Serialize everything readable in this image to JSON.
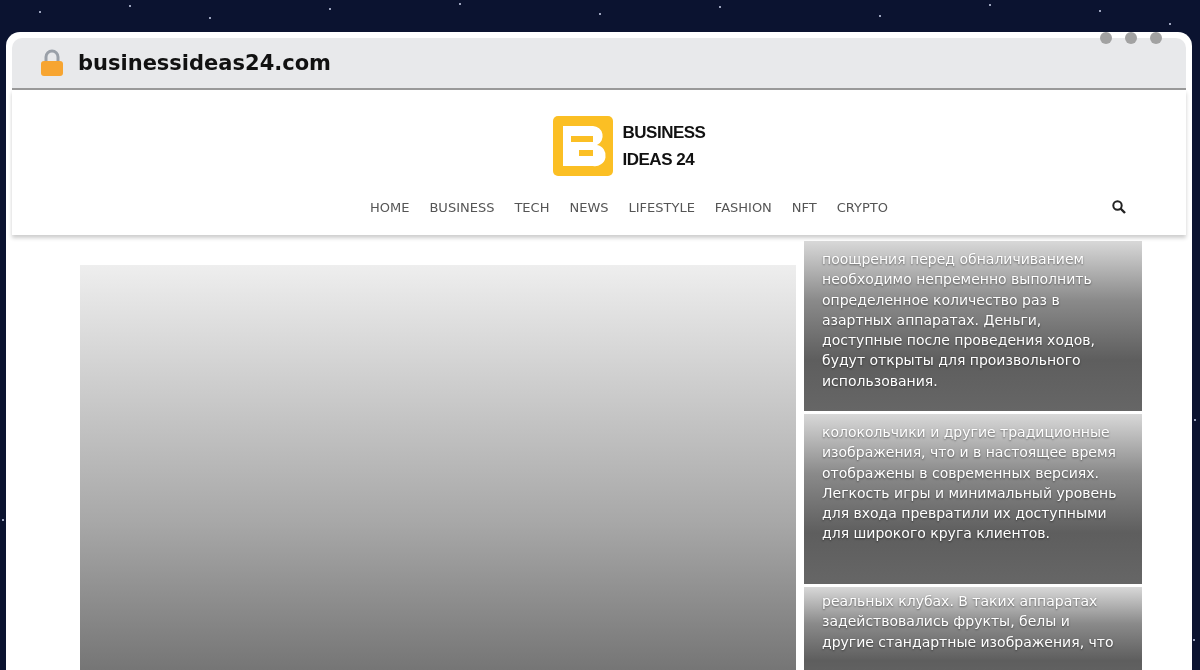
{
  "browser": {
    "url": "businessideas24.com"
  },
  "header": {
    "logo_lines": [
      "BUSINESS",
      "IDEAS 24"
    ],
    "nav": [
      {
        "label": "HOME"
      },
      {
        "label": "BUSINESS"
      },
      {
        "label": "TECH"
      },
      {
        "label": "NEWS"
      },
      {
        "label": "LIFESTYLE"
      },
      {
        "label": "FASHION"
      },
      {
        "label": "NFT"
      },
      {
        "label": "CRYPTO"
      }
    ]
  },
  "side_cards": [
    {
      "text": "поощрения перед обналичиванием необходимо непременно выполнить определенное количество раз в азартных аппаратах. Деньги, доступные после проведения ходов, будут открыты для произвольного использования."
    },
    {
      "text": "колокольчики и другие традиционные изображения, что и в настоящее время отображены в современных версиях. Легкость игры и минимальный уровень для входа превратили их доступными для широкого круга клиентов."
    },
    {
      "text": "реальных клубах. В таких аппаратах задействовались фрукты, белы и другие стандартные изображения, что"
    }
  ]
}
